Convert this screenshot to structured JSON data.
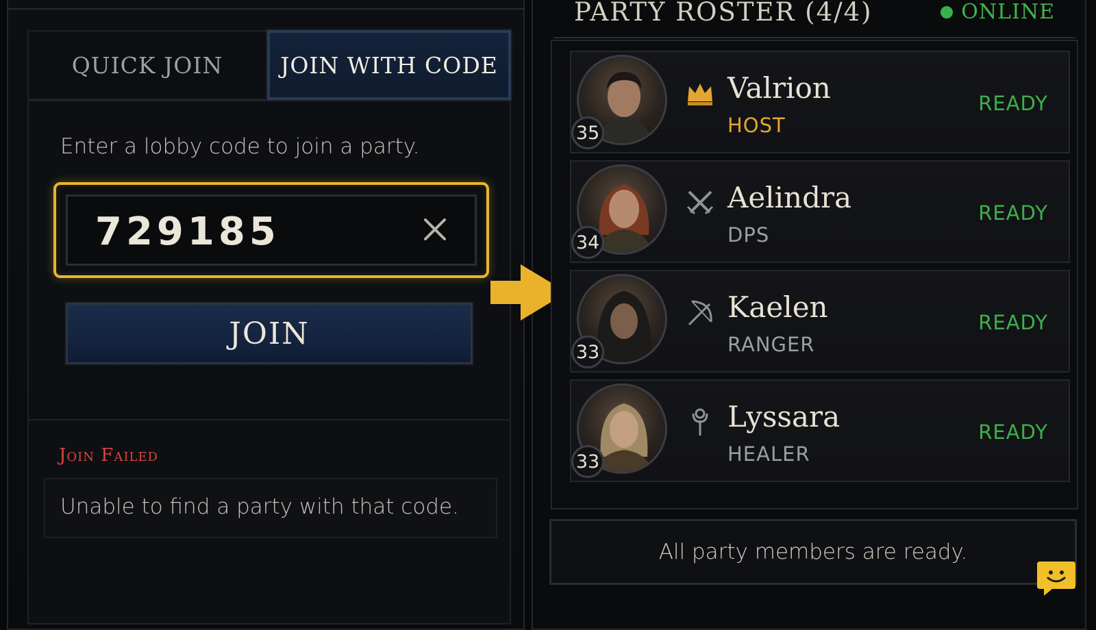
{
  "join_panel": {
    "tabs": [
      {
        "label": "QUICK JOIN",
        "active": false
      },
      {
        "label": "JOIN WITH CODE",
        "active": true
      }
    ],
    "instruction": "Enter a lobby code to join a party.",
    "code_input": {
      "value": "729185",
      "placeholder": ""
    },
    "clear_icon": "close-icon",
    "join_label": "JOIN",
    "error": {
      "title": "Join Failed",
      "message": "Unable to find a party with that code."
    }
  },
  "roster": {
    "title": "PARTY ROSTER (4/4)",
    "online_label": "ONLINE",
    "members": [
      {
        "name": "Valrion",
        "role": "HOST",
        "level": "35",
        "status": "READY",
        "role_icon": "crown-icon"
      },
      {
        "name": "Aelindra",
        "role": "DPS",
        "level": "34",
        "status": "READY",
        "role_icon": "crossed-swords-icon"
      },
      {
        "name": "Kaelen",
        "role": "RANGER",
        "level": "33",
        "status": "READY",
        "role_icon": "bow-icon"
      },
      {
        "name": "Lyssara",
        "role": "HEALER",
        "level": "33",
        "status": "READY",
        "role_icon": "staff-icon"
      }
    ],
    "footer_status": "All party members are ready."
  },
  "colors": {
    "accent_gold": "#e8b62b",
    "ready_green": "#3db04c",
    "error_red": "#d8453d",
    "host_orange": "#e3a632",
    "button_blue": "#142440"
  },
  "chat_icon": "chat-bubble-icon"
}
